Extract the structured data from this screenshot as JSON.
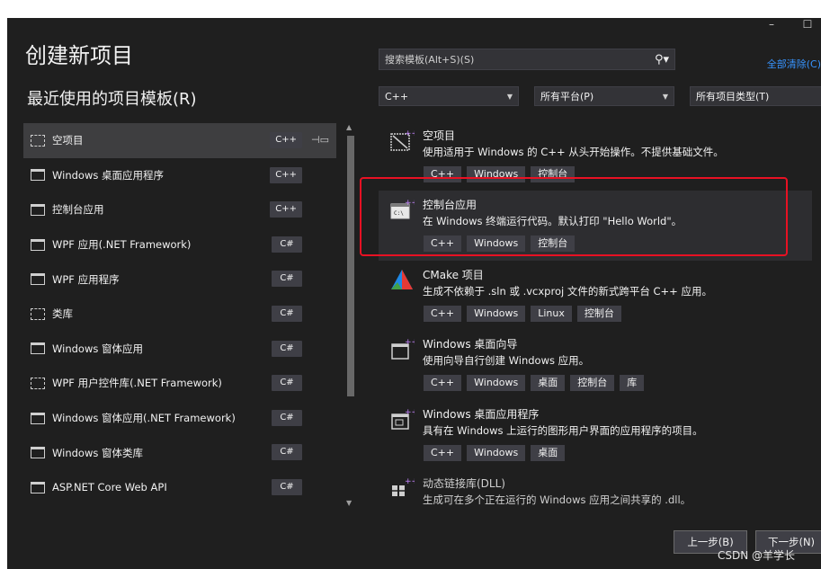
{
  "window": {
    "minimize_glyph": "–",
    "maximize_glyph": "☐"
  },
  "title": "创建新项目",
  "recent_heading": "最近使用的项目模板(R)",
  "search": {
    "placeholder": "搜索模板(Alt+S)(S)",
    "icon": "search-icon"
  },
  "clear_all": "全部清除(C)",
  "filters": {
    "language": "C++",
    "platform": "所有平台(P)",
    "project_type": "所有项目类型(T)"
  },
  "recent_templates": [
    {
      "name": "空项目",
      "lang": "C++",
      "icon": "empty-project-icon",
      "selected": true,
      "pinned": true
    },
    {
      "name": "Windows 桌面应用程序",
      "lang": "C++",
      "icon": "windows-desktop-icon"
    },
    {
      "name": "控制台应用",
      "lang": "C++",
      "icon": "console-app-icon"
    },
    {
      "name": "WPF 应用(.NET Framework)",
      "lang": "C#",
      "icon": "wpf-app-icon"
    },
    {
      "name": "WPF 应用程序",
      "lang": "C#",
      "icon": "wpf-app-icon"
    },
    {
      "name": "类库",
      "lang": "C#",
      "icon": "class-library-icon"
    },
    {
      "name": "Windows 窗体应用",
      "lang": "C#",
      "icon": "windows-forms-icon"
    },
    {
      "name": "WPF 用户控件库(.NET Framework)",
      "lang": "C#",
      "icon": "wpf-control-library-icon"
    },
    {
      "name": "Windows 窗体应用(.NET Framework)",
      "lang": "C#",
      "icon": "windows-forms-icon"
    },
    {
      "name": "Windows 窗体类库",
      "lang": "C#",
      "icon": "windows-forms-library-icon"
    },
    {
      "name": "ASP.NET Core Web API",
      "lang": "C#",
      "icon": "web-api-icon"
    }
  ],
  "templates": [
    {
      "name": "空项目",
      "description": "使用适用于 Windows 的 C++ 从头开始操作。不提供基础文件。",
      "tags": [
        "C++",
        "Windows",
        "控制台"
      ],
      "icon": "empty-project-icon"
    },
    {
      "name": "控制台应用",
      "description": "在 Windows 终端运行代码。默认打印 \"Hello World\"。",
      "tags": [
        "C++",
        "Windows",
        "控制台"
      ],
      "icon": "console-app-icon",
      "selected": true
    },
    {
      "name": "CMake 项目",
      "description": "生成不依赖于 .sln 或 .vcxproj 文件的新式跨平台 C++ 应用。",
      "tags": [
        "C++",
        "Windows",
        "Linux",
        "控制台"
      ],
      "icon": "cmake-icon"
    },
    {
      "name": "Windows 桌面向导",
      "description": "使用向导自行创建 Windows 应用。",
      "tags": [
        "C++",
        "Windows",
        "桌面",
        "控制台",
        "库"
      ],
      "icon": "desktop-wizard-icon"
    },
    {
      "name": "Windows 桌面应用程序",
      "description": "具有在 Windows 上运行的图形用户界面的应用程序的项目。",
      "tags": [
        "C++",
        "Windows",
        "桌面"
      ],
      "icon": "windows-desktop-icon"
    },
    {
      "name": "动态链接库(DLL)",
      "description": "生成可在多个正在运行的 Windows 应用之间共享的 .dll。",
      "tags": [],
      "icon": "dll-icon",
      "faded": true
    }
  ],
  "buttons": {
    "back": "上一步(B)",
    "next": "下一步(N)"
  },
  "watermark": "CSDN @羊学长",
  "colors": {
    "background": "#1f1f1f",
    "accent": "#3794ff",
    "highlight": "#e81123"
  }
}
